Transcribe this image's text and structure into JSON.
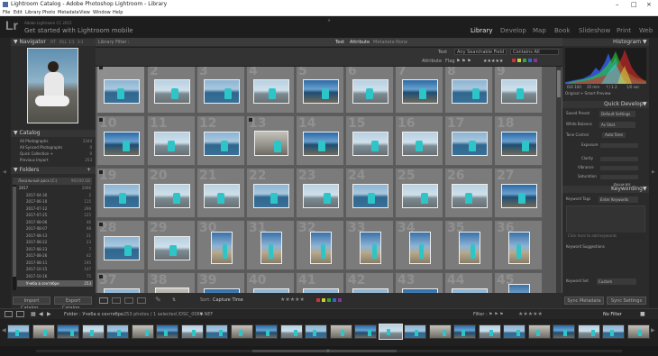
{
  "window": {
    "title": "Lightroom Catalog - Adobe Photoshop Lightroom - Library"
  },
  "menu": [
    "File",
    "Edit",
    "Library",
    "Photo",
    "Metadata",
    "View",
    "Window",
    "Help"
  ],
  "identity": {
    "brand": "Adobe Lightroom CC 2015",
    "plate": "Get started with Lightroom mobile"
  },
  "modules": [
    "Library",
    "Develop",
    "Map",
    "Book",
    "Slideshow",
    "Print",
    "Web"
  ],
  "active_module": "Library",
  "navigator": {
    "title": "Navigator",
    "zoom_labels": [
      "FIT",
      "FILL",
      "1:1",
      "3:1"
    ]
  },
  "catalog": {
    "title": "Catalog",
    "items": [
      {
        "label": "All Photographs",
        "count": "2344"
      },
      {
        "label": "All Synced Photographs",
        "count": "0"
      },
      {
        "label": "Quick Collection +",
        "count": "0"
      },
      {
        "label": "Previous Import",
        "count": "253"
      }
    ]
  },
  "folders": {
    "title": "Folders",
    "volume": {
      "label": "Локальный диск (C:)",
      "space": "96/100 GB"
    },
    "year": {
      "label": "2017",
      "count": "2096"
    },
    "items": [
      {
        "label": "2017-04-30",
        "count": "2"
      },
      {
        "label": "2017-06-10",
        "count": "115"
      },
      {
        "label": "2017-07-12",
        "count": "296"
      },
      {
        "label": "2017-07-25",
        "count": "125"
      },
      {
        "label": "2017-08-06",
        "count": "46"
      },
      {
        "label": "2017-08-07",
        "count": "98"
      },
      {
        "label": "2017-08-13",
        "count": "21"
      },
      {
        "label": "2017-08-22",
        "count": "23"
      },
      {
        "label": "2017-08-23",
        "count": "7"
      },
      {
        "label": "2017-08-26",
        "count": "42"
      },
      {
        "label": "2017-08-11",
        "count": "195"
      },
      {
        "label": "2017-10-15",
        "count": "147"
      },
      {
        "label": "2017-10-16",
        "count": "75"
      },
      {
        "label": "Учеба в сентябре",
        "count": "253"
      }
    ]
  },
  "left_buttons": {
    "import": "Import Catalog...",
    "export": "Export Catalog..."
  },
  "library_filter": {
    "title": "Library Filter :",
    "tabs": [
      "Text",
      "Attribute",
      "Metadata",
      "None"
    ],
    "text_label": "Text",
    "any_field": "Any Searchable Field",
    "contains": "Contains All",
    "attribute_label": "Attribute",
    "flag_label": "Flag"
  },
  "grid": {
    "cell_numbers": [
      "1",
      "2",
      "3",
      "4",
      "5",
      "6",
      "7",
      "8",
      "9",
      "10",
      "11",
      "12",
      "13",
      "14",
      "15",
      "16",
      "17",
      "18",
      "19",
      "20",
      "21",
      "22",
      "23",
      "24",
      "25",
      "26",
      "27",
      "28",
      "29",
      "30",
      "31",
      "32",
      "33",
      "34",
      "35",
      "36",
      "37",
      "38",
      "39",
      "40",
      "41",
      "42",
      "43",
      "44",
      "45"
    ]
  },
  "toolbar": {
    "sort_label": "Sort:",
    "sort_value": "Capture Time"
  },
  "histogram": {
    "title": "Histogram",
    "info": [
      "ISO 100",
      "35 mm",
      "f / 1.2",
      "1/0 sec"
    ],
    "preview_label": "Original + Smart Preview",
    "colors": {
      "red": "#e0282c",
      "green": "#2bd433",
      "blue": "#3a64ff",
      "cyan": "#3bd8e8",
      "yellow": "#e8e03a"
    }
  },
  "quick_develop": {
    "title": "Quick Develop",
    "saved_preset": {
      "label": "Saved Preset",
      "value": "Default Settings"
    },
    "white_balance": {
      "label": "White Balance",
      "value": "As Shot"
    },
    "tone_control": {
      "label": "Tone Control",
      "value": "Auto Tone"
    },
    "rows": [
      "Exposure",
      "Clarity",
      "Vibrance",
      "Saturation"
    ],
    "reset": "Reset All"
  },
  "keywording": {
    "title": "Keywording",
    "tags_label": "Keyword Tags",
    "tags_value": "Enter Keywords",
    "placeholder": "Click here to add keywords",
    "suggestions": "Keyword Suggestions",
    "keyword_set": {
      "label": "Keyword Set",
      "value": "Custom"
    }
  },
  "right_buttons": {
    "sync_metadata": "Sync Metadata",
    "sync_settings": "Sync Settings"
  },
  "filmstrip": {
    "pages": [
      "1",
      "2"
    ],
    "folder_label": "Folder : Учеба в сентябре",
    "count_text": "253 photos / 1 selected /DSC_0080.NEF",
    "filter_label": "Filter :",
    "filter_value": "No Filter"
  }
}
